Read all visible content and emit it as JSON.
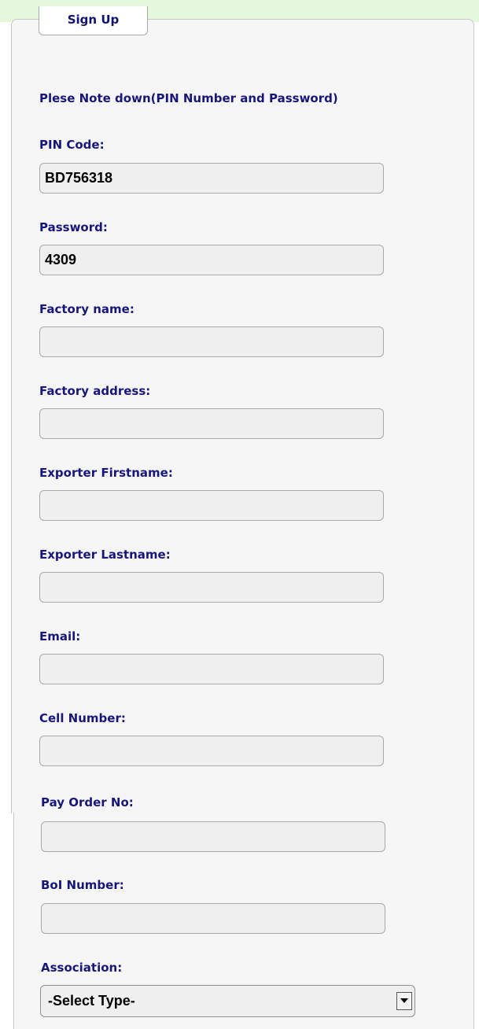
{
  "tab": {
    "label": "Sign Up"
  },
  "note": "Plese Note down(PIN Number and Password)",
  "fields": [
    {
      "label": "PIN Code:",
      "value": "BD756318"
    },
    {
      "label": "Password:",
      "value": "4309"
    },
    {
      "label": "Factory name:",
      "value": ""
    },
    {
      "label": "Factory address:",
      "value": ""
    },
    {
      "label": "Exporter Firstname:",
      "value": ""
    },
    {
      "label": "Exporter Lastname:",
      "value": ""
    },
    {
      "label": "Email:",
      "value": ""
    },
    {
      "label": "Cell Number:",
      "value": ""
    },
    {
      "label": "Pay Order No:",
      "value": ""
    },
    {
      "label": "BoI Number:",
      "value": ""
    }
  ],
  "association": {
    "label": "Association:",
    "selected": "-Select Type-"
  },
  "colors": {
    "label_text": "#17177a",
    "panel_background": "#f6f6f6",
    "top_strip": "#e4f8dc",
    "input_background": "#efefef"
  }
}
